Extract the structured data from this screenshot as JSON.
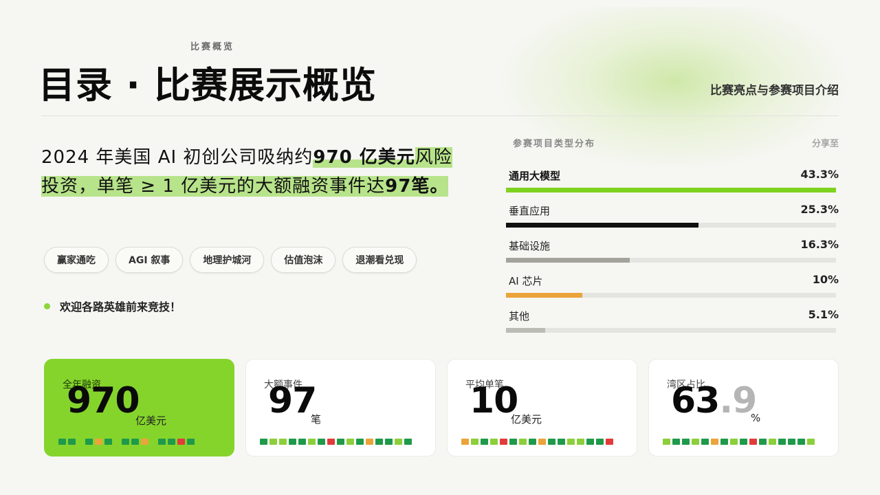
{
  "header": {
    "kicker": "比赛概览",
    "title": "目录 · 比赛展示概览",
    "subtitle": "比赛亮点与参赛项目介绍"
  },
  "lead": {
    "part1": "2024 年美国 AI 初创公司吸纳约",
    "highlight1": "970 亿美元",
    "part2": "风险投资，单笔 ≥ 1 亿美元的大额融资事件达",
    "highlight2": "97",
    "part3": "笔。"
  },
  "tags": [
    "赢家通吃",
    "AGI 叙事",
    "地理护城河",
    "估值泡沫",
    "退潮看兑现"
  ],
  "welcome": "欢迎各路英雄前来竞技！",
  "distribution": {
    "title": "参赛项目类型分布",
    "share_label": "分享至",
    "items": [
      {
        "label": "通用大模型",
        "value": "43.3%",
        "pct": 100,
        "color": "#7ed321"
      },
      {
        "label": "垂直应用",
        "value": "25.3%",
        "pct": 58.4,
        "color": "#111111"
      },
      {
        "label": "基础设施",
        "value": "16.3%",
        "pct": 37.6,
        "color": "#a3a39c"
      },
      {
        "label": "AI 芯片",
        "value": "10%",
        "pct": 23.1,
        "color": "#eaa43a"
      },
      {
        "label": "其他",
        "value": "5.1%",
        "pct": 11.8,
        "color": "#bcbcb6"
      }
    ]
  },
  "cards": [
    {
      "caption": "全年融资",
      "number": "970",
      "decimal": "",
      "unit": "亿美元",
      "primary": true,
      "segments": [
        "#1f9a4a",
        "#1f9a4a",
        "gap",
        "#1f9a4a",
        "#eaa43a",
        "#1f9a4a",
        "gap",
        "#1f9a4a",
        "#1f9a4a",
        "#eaa43a",
        "gap",
        "#1f9a4a",
        "#1f9a4a",
        "#e23b3b",
        "#1f9a4a"
      ]
    },
    {
      "caption": "大额事件",
      "number": "97",
      "decimal": "",
      "unit": "笔",
      "primary": false,
      "segments": [
        "#1f9a4a",
        "#8ccf3a",
        "#8ccf3a",
        "#1f9a4a",
        "#1f9a4a",
        "#8ccf3a",
        "#1f9a4a",
        "#e23b3b",
        "#1f9a4a",
        "#8ccf3a",
        "#1f9a4a",
        "#eaa43a",
        "#1f9a4a",
        "#1f9a4a",
        "#8ccf3a",
        "#1f9a4a"
      ]
    },
    {
      "caption": "平均单笔",
      "number": "10",
      "decimal": "",
      "unit": "亿美元",
      "primary": false,
      "segments": [
        "#eaa43a",
        "#8ccf3a",
        "#1f9a4a",
        "#8ccf3a",
        "#e23b3b",
        "#1f9a4a",
        "#8ccf3a",
        "#1f9a4a",
        "#eaa43a",
        "#1f9a4a",
        "#1f9a4a",
        "#8ccf3a",
        "#8ccf3a",
        "#1f9a4a",
        "#1f9a4a",
        "#e23b3b"
      ]
    },
    {
      "caption": "湾区占比",
      "number": "63",
      "decimal": ".9",
      "unit": "%",
      "primary": false,
      "segments": [
        "#8ccf3a",
        "#1f9a4a",
        "#1f9a4a",
        "#8ccf3a",
        "#1f9a4a",
        "#eaa43a",
        "#1f9a4a",
        "#8ccf3a",
        "#1f9a4a",
        "#e23b3b",
        "#1f9a4a",
        "#8ccf3a",
        "#1f9a4a",
        "#1f9a4a",
        "#1f9a4a",
        "#8ccf3a"
      ]
    }
  ]
}
